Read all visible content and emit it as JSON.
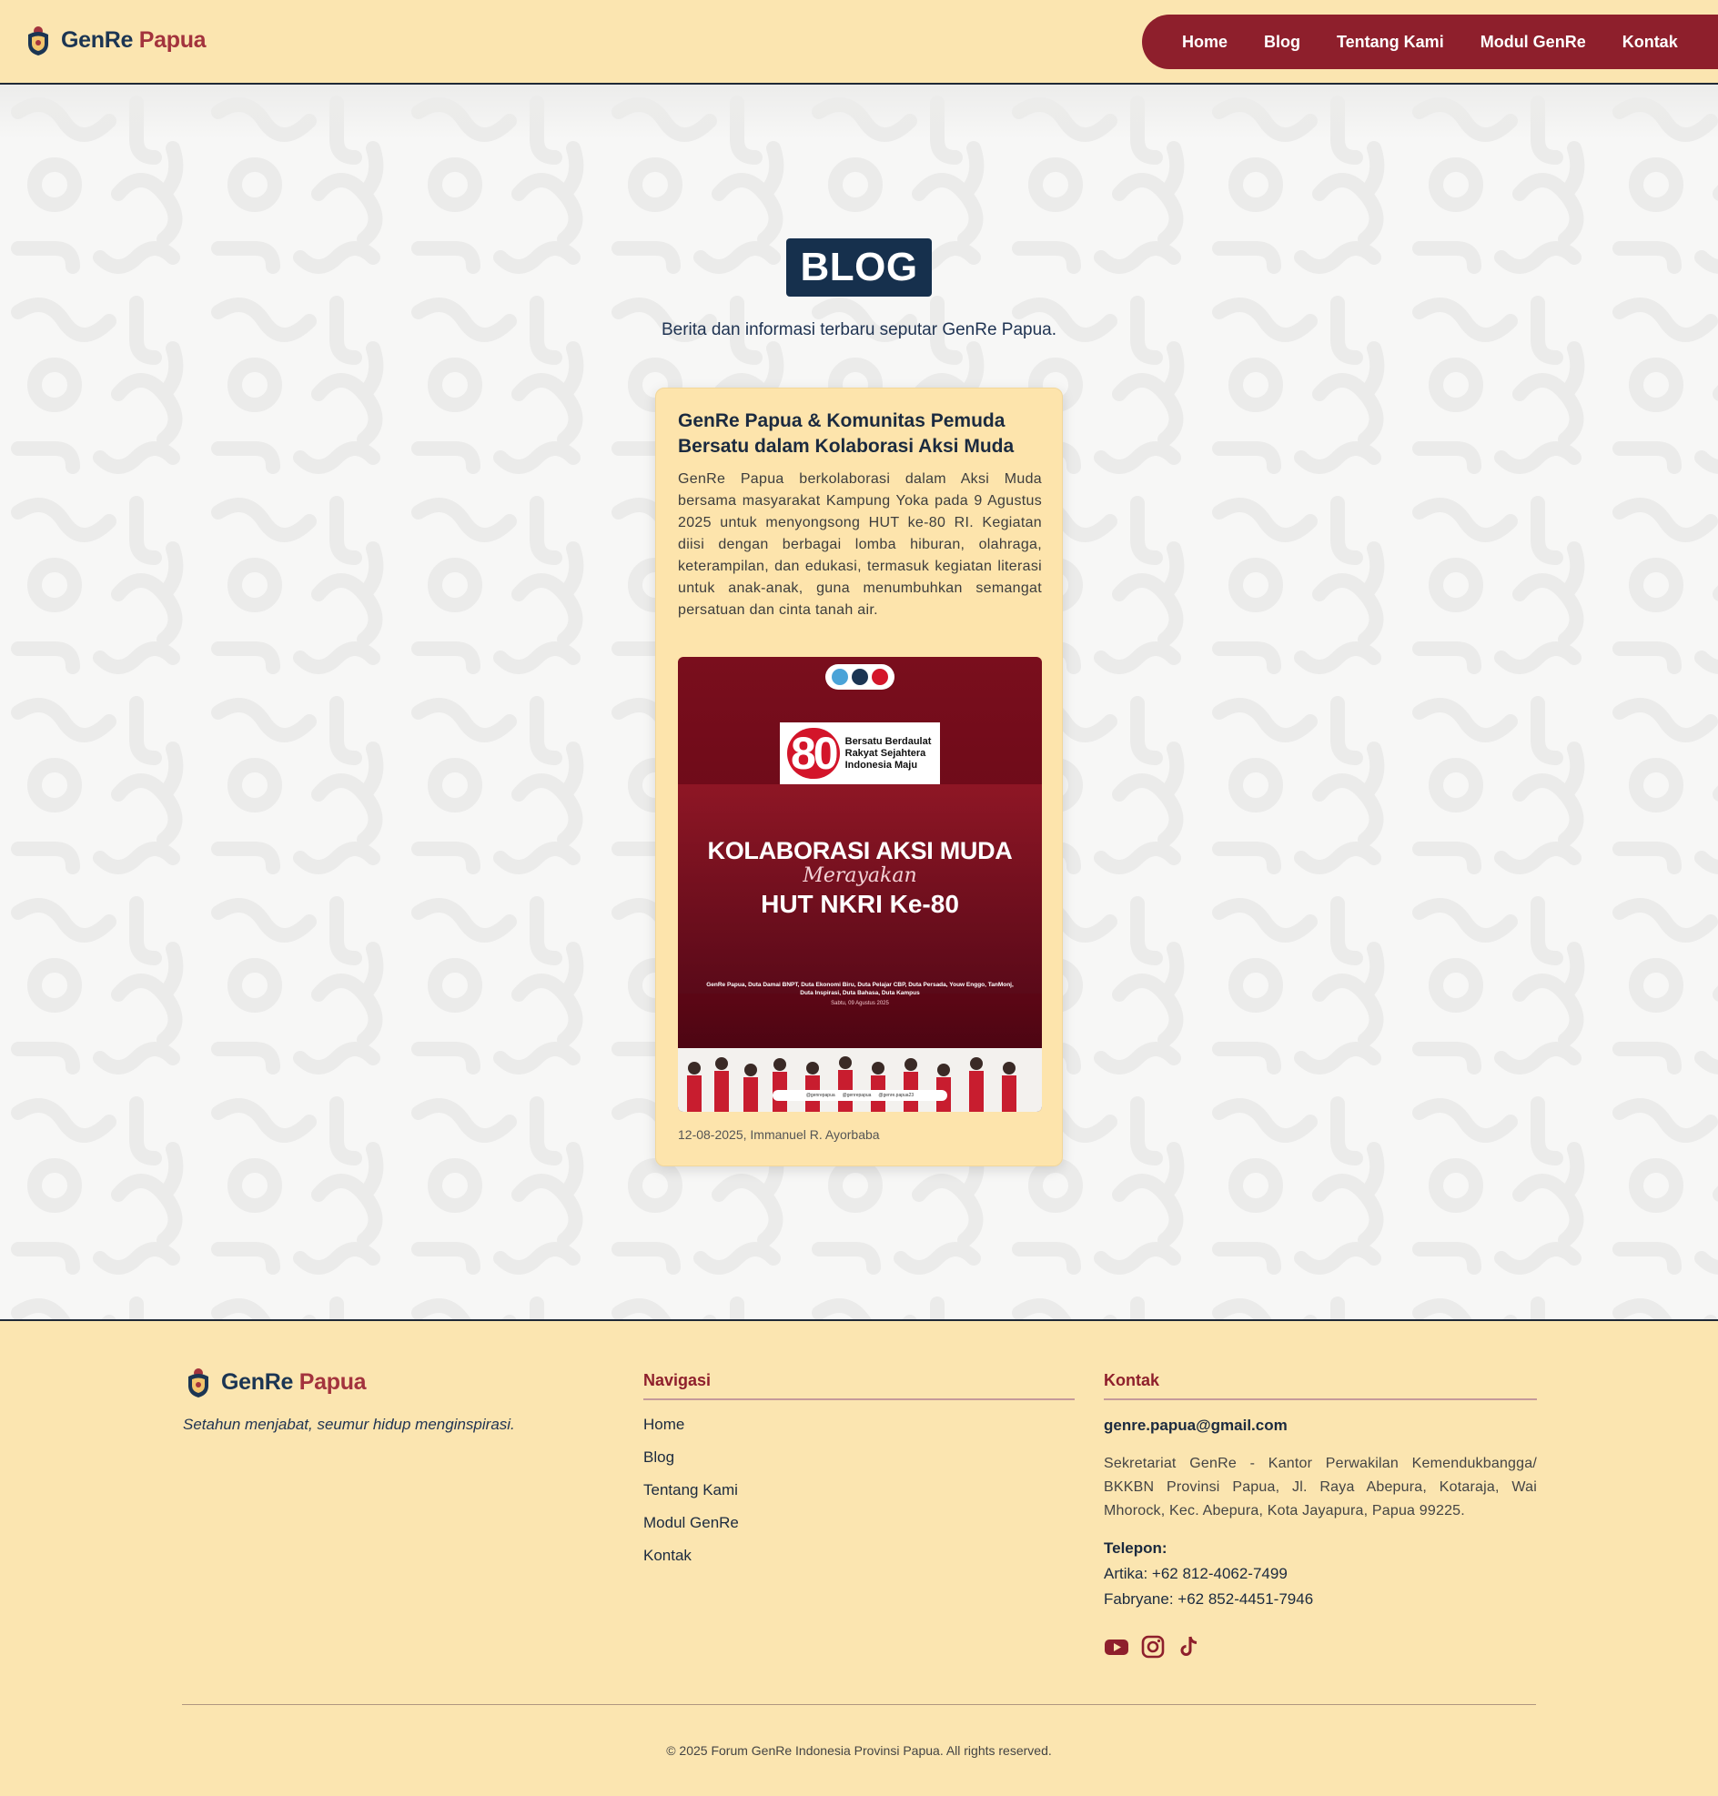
{
  "brand": {
    "name_part1": "GenRe",
    "name_part2": "Papua"
  },
  "nav": {
    "items": [
      {
        "label": "Home"
      },
      {
        "label": "Blog"
      },
      {
        "label": "Tentang Kami"
      },
      {
        "label": "Modul GenRe"
      },
      {
        "label": "Kontak"
      }
    ]
  },
  "hero": {
    "title": "BLOG",
    "subtitle": "Berita dan informasi terbaru seputar GenRe Papua."
  },
  "post": {
    "title": "GenRe Papua & Komunitas Pemuda Bersatu dalam Kolaborasi Aksi Muda",
    "excerpt": "GenRe Papua berkolaborasi dalam Aksi Muda bersama masyarakat Kampung Yoka pada 9 Agustus 2025 untuk menyongsong HUT ke-80 RI. Kegiatan diisi dengan berbagai lomba hiburan, olahraga, keterampilan, dan edukasi, termasuk kegiatan literasi untuk anak-anak, guna menumbuhkan semangat persatuan dan cinta tanah air.",
    "meta": "12-08-2025, Immanuel R. Ayorbaba",
    "poster": {
      "badge_number": "80",
      "badge_text": "Bersatu Berdaulat Rakyat Sejahtera Indonesia Maju",
      "headline1": "KOLABORASI AKSI MUDA",
      "script": "Merayakan",
      "headline2": "HUT NKRI Ke-80",
      "credits": "GenRe Papua, Duta Damai BNPT, Duta Ekonomi Biru, Duta Pelajar CBP, Duta Persada, Youw Enggo, TanMonj, Duta Inspirasi, Duta Bahasa, Duta Kampus",
      "date": "Sabtu, 09 Agustus 2025",
      "social": [
        "@genrepapua",
        "@genrepapua",
        "@genre.papua23"
      ]
    }
  },
  "footer": {
    "tagline": "Setahun menjabat, seumur hidup menginspirasi.",
    "nav_title": "Navigasi",
    "nav_items": [
      "Home",
      "Blog",
      "Tentang Kami",
      "Modul GenRe",
      "Kontak"
    ],
    "contact_title": "Kontak",
    "email": "genre.papua@gmail.com",
    "address": "Sekretariat GenRe - Kantor Perwakilan Kemendukbangga/ BKKBN Provinsi Papua, Jl. Raya Abepura, Kotaraja, Wai Mhorock, Kec. Abepura, Kota Jayapura, Papua 99225.",
    "phone_label": "Telepon:",
    "phones": [
      "Artika: +62 812-4062-7499",
      "Fabryane: +62 852-4451-7946"
    ],
    "social_icons": [
      "youtube-icon",
      "instagram-icon",
      "tiktok-icon"
    ],
    "copyright": "© 2025 Forum GenRe Indonesia Provinsi Papua. All rights reserved."
  },
  "colors": {
    "header_bg": "#fbe5b0",
    "nav_bg": "#8e1f2c",
    "title_bg": "#16304d",
    "card_bg": "#fde4ac",
    "accent_red": "#a3333d",
    "brand_navy": "#1b3553"
  }
}
